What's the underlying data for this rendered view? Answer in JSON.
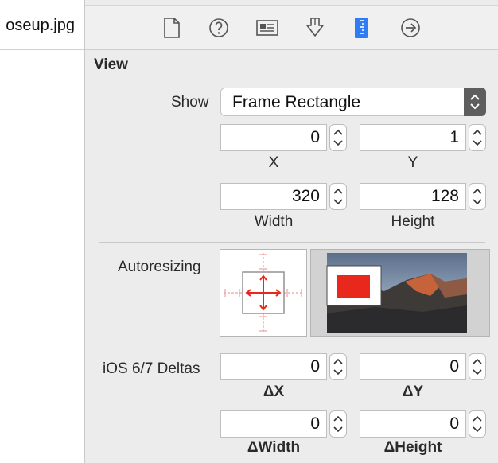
{
  "file_tab": {
    "name": "oseup.jpg"
  },
  "toolbar": {
    "icons": [
      "file-inspector-icon",
      "quick-help-icon",
      "identity-inspector-icon",
      "attributes-inspector-icon",
      "size-inspector-icon",
      "connections-inspector-icon"
    ],
    "active_color": "#2f7cf6"
  },
  "view": {
    "title": "View",
    "show_label": "Show",
    "show_value": "Frame Rectangle",
    "x": {
      "value": "0",
      "label": "X"
    },
    "y": {
      "value": "1",
      "label": "Y"
    },
    "width": {
      "value": "320",
      "label": "Width"
    },
    "height": {
      "value": "128",
      "label": "Height"
    },
    "autoresizing_label": "Autoresizing",
    "deltas_label": "iOS 6/7 Deltas",
    "dx": {
      "value": "0",
      "label": "ΔX"
    },
    "dy": {
      "value": "0",
      "label": "ΔY"
    },
    "dwidth": {
      "value": "0",
      "label": "ΔWidth"
    },
    "dheight": {
      "value": "0",
      "label": "ΔHeight"
    }
  },
  "colors": {
    "autoresize_red": "#e8281c",
    "strut_pink": "#f0a0a0"
  }
}
